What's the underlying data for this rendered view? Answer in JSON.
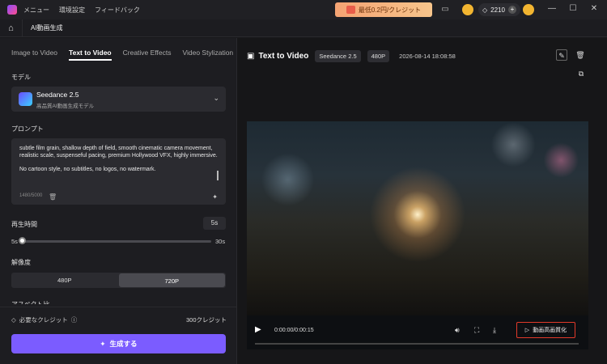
{
  "titlebar": {
    "menu": [
      "メニュー",
      "環境設定",
      "フィードバック"
    ],
    "promo": "最低0.2円/クレジット",
    "credits": "2210"
  },
  "subbar": {
    "title": "AI動画生成"
  },
  "tabs": [
    {
      "label": "Image to Video",
      "active": false
    },
    {
      "label": "Text to Video",
      "active": true
    },
    {
      "label": "Creative Effects",
      "active": false
    },
    {
      "label": "Video Stylization",
      "active": false
    }
  ],
  "model": {
    "section": "モデル",
    "name": "Seedance 2.5",
    "desc": "高品質AI動画生成モデル"
  },
  "prompt": {
    "section": "プロンプト",
    "text1": "subtle film grain, shallow depth of field, smooth cinematic camera movement, realistic scale, suspenseful pacing, premium Hollywood VFX, highly immersive.",
    "text2": "No cartoon style, no subtitles, no logos, no watermark.",
    "count": "1480/5000"
  },
  "duration": {
    "section": "再生時間",
    "value": "5s",
    "min": "5s",
    "max": "30s",
    "level": 0
  },
  "resolution": {
    "section": "解像度",
    "options": [
      "480P",
      "720P"
    ],
    "selected": "720P"
  },
  "aspect_label": "アスペクト比",
  "footer": {
    "required_label": "必要なクレジット",
    "required_value": "300クレジット",
    "generate": "生成する"
  },
  "right": {
    "title": "Text to Video",
    "model_pill": "Seedance 2.5",
    "res_pill": "480P",
    "date": "2026-08-14 18:08:58"
  },
  "player": {
    "time": "0:00:00/0:00:15",
    "enhance": "動画高画質化",
    "progress": 0
  },
  "colors": {
    "accent": "#7b5cff",
    "highlight": "#e23a2a"
  }
}
